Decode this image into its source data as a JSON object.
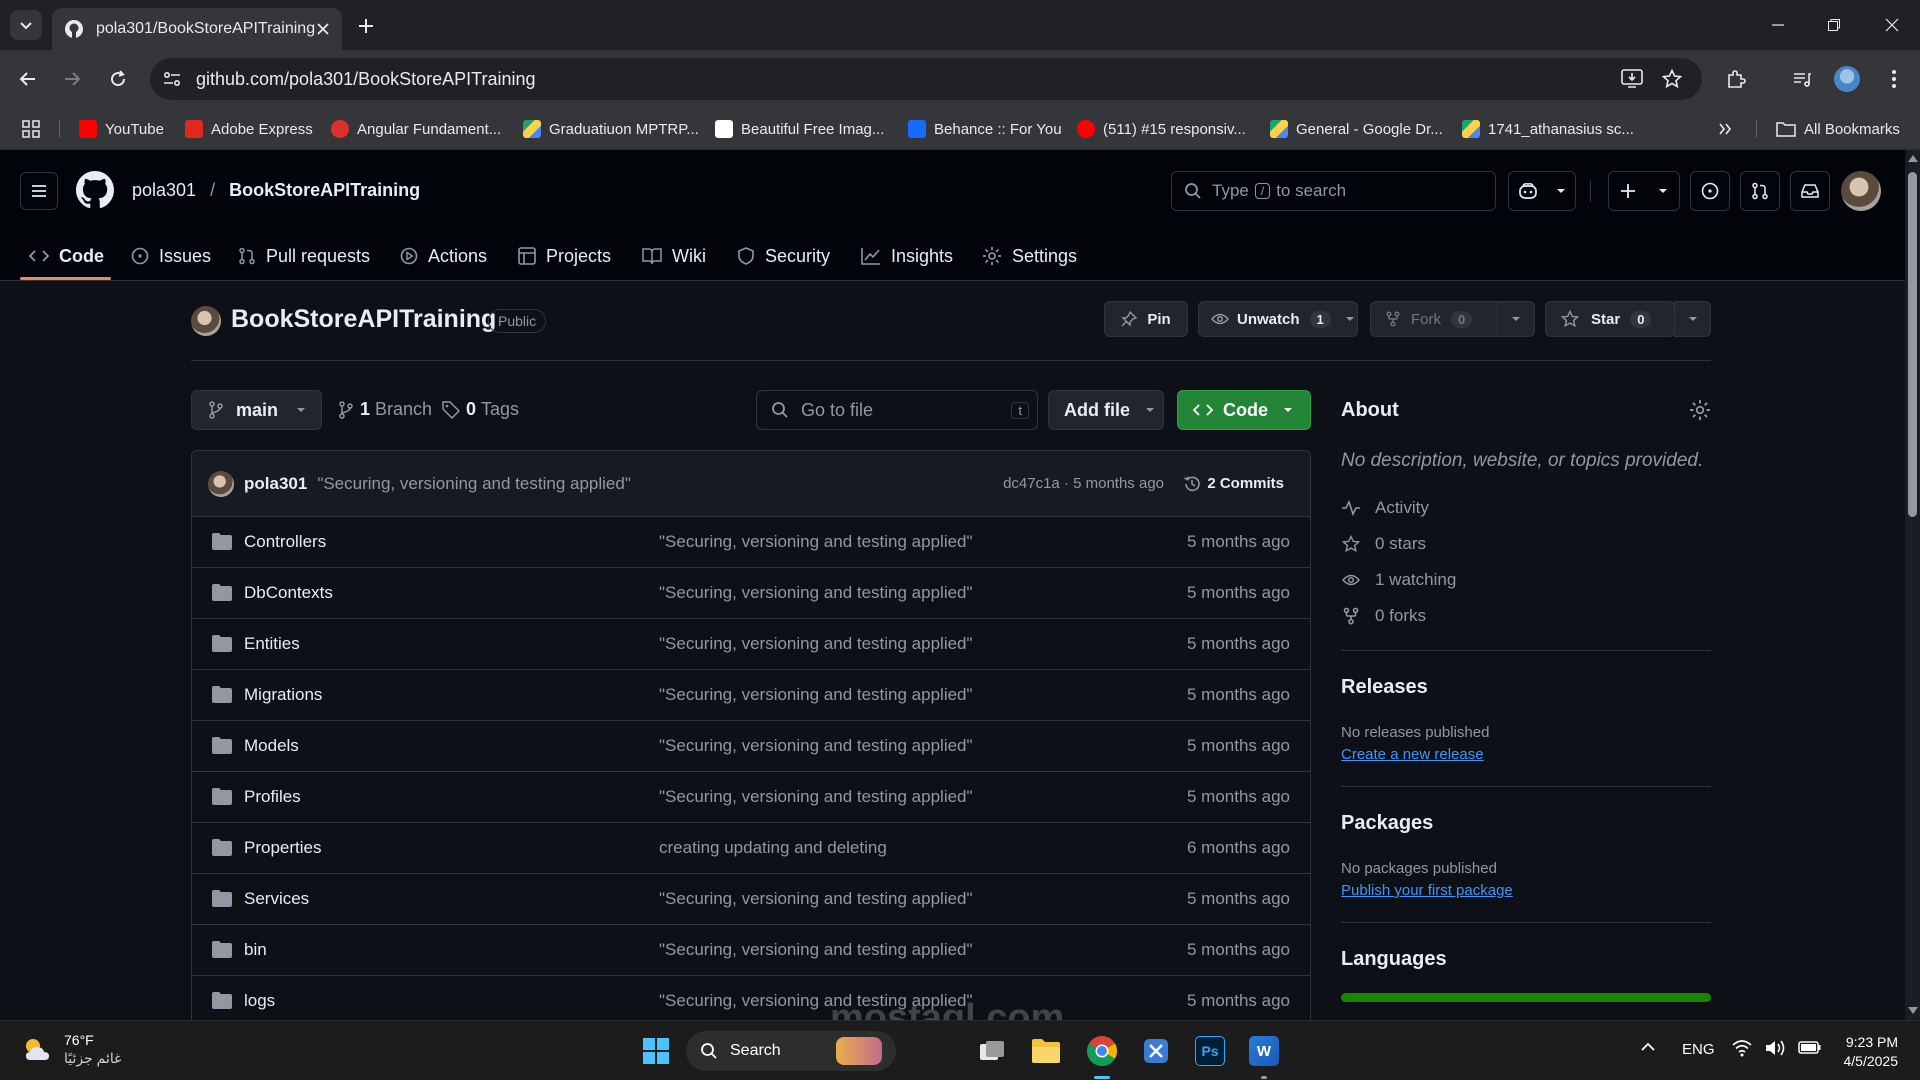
{
  "browser": {
    "tab_title": "pola301/BookStoreAPITraining",
    "url": "github.com/pola301/BookStoreAPITraining",
    "all_bookmarks": "All Bookmarks",
    "bookmarks": [
      {
        "label": "YouTube",
        "color": "#ff0000"
      },
      {
        "label": "Adobe Express",
        "color": "#e0281f"
      },
      {
        "label": "Angular Fundament...",
        "color": "#dd3131"
      },
      {
        "label": "Graduatiuon MPTRP...",
        "color": "#1fa463"
      },
      {
        "label": "Beautiful Free Imag...",
        "color": "#ffffff"
      },
      {
        "label": "Behance :: For You",
        "color": "#1769ff"
      },
      {
        "label": "(511) #15 responsiv...",
        "color": "#ff0000"
      },
      {
        "label": "General - Google Dr...",
        "color": "#ffba00"
      },
      {
        "label": "1741_athanasius sc...",
        "color": "#ffba00"
      }
    ]
  },
  "header": {
    "owner": "pola301",
    "separator": "/",
    "repo": "BookStoreAPITraining",
    "search_placeholder_pre": "Type",
    "search_key": "/",
    "search_placeholder_post": "to search"
  },
  "tabs": [
    {
      "label": "Code",
      "icon": "code-icon"
    },
    {
      "label": "Issues",
      "icon": "issue-icon"
    },
    {
      "label": "Pull requests",
      "icon": "pull-request-icon"
    },
    {
      "label": "Actions",
      "icon": "play-icon"
    },
    {
      "label": "Projects",
      "icon": "table-icon"
    },
    {
      "label": "Wiki",
      "icon": "book-icon"
    },
    {
      "label": "Security",
      "icon": "shield-icon"
    },
    {
      "label": "Insights",
      "icon": "graph-icon"
    },
    {
      "label": "Settings",
      "icon": "gear-icon"
    }
  ],
  "repo": {
    "name": "BookStoreAPITraining",
    "visibility": "Public",
    "pin": "Pin",
    "unwatch": "Unwatch",
    "watch_count": "1",
    "fork": "Fork",
    "fork_count": "0",
    "star": "Star",
    "star_count": "0"
  },
  "controls": {
    "branch": "main",
    "branch_count": "1",
    "branch_label": "Branch",
    "tag_count": "0",
    "tag_label": "Tags",
    "go_to_file": "Go to file",
    "go_to_file_key": "t",
    "add_file": "Add file",
    "code": "Code"
  },
  "latest_commit": {
    "author": "pola301",
    "message": "\"Securing, versioning and testing applied\"",
    "hash_age": "dc47c1a · 5 months ago",
    "commits": "2 Commits"
  },
  "files": [
    {
      "name": "Controllers",
      "message": "\"Securing, versioning and testing applied\"",
      "age": "5 months ago"
    },
    {
      "name": "DbContexts",
      "message": "\"Securing, versioning and testing applied\"",
      "age": "5 months ago"
    },
    {
      "name": "Entities",
      "message": "\"Securing, versioning and testing applied\"",
      "age": "5 months ago"
    },
    {
      "name": "Migrations",
      "message": "\"Securing, versioning and testing applied\"",
      "age": "5 months ago"
    },
    {
      "name": "Models",
      "message": "\"Securing, versioning and testing applied\"",
      "age": "5 months ago"
    },
    {
      "name": "Profiles",
      "message": "\"Securing, versioning and testing applied\"",
      "age": "5 months ago"
    },
    {
      "name": "Properties",
      "message": "creating updating and deleting",
      "age": "6 months ago"
    },
    {
      "name": "Services",
      "message": "\"Securing, versioning and testing applied\"",
      "age": "5 months ago"
    },
    {
      "name": "bin",
      "message": "\"Securing, versioning and testing applied\"",
      "age": "5 months ago"
    },
    {
      "name": "logs",
      "message": "\"Securing, versioning and testing applied\"",
      "age": "5 months ago"
    }
  ],
  "about": {
    "title": "About",
    "description": "No description, website, or topics provided.",
    "activity": "Activity",
    "stars": "0 stars",
    "watching": "1 watching",
    "forks": "0 forks",
    "releases_title": "Releases",
    "releases_none": "No releases published",
    "releases_link": "Create a new release",
    "packages_title": "Packages",
    "packages_none": "No packages published",
    "packages_link": "Publish your first package",
    "languages_title": "Languages",
    "language_bar_color": "#178600"
  },
  "taskbar": {
    "temp": "76°F",
    "weather": "غائم جزئيًا",
    "search": "Search",
    "lang": "ENG",
    "time": "9:23 PM",
    "date": "4/5/2025"
  },
  "watermark": "mostaql.com"
}
